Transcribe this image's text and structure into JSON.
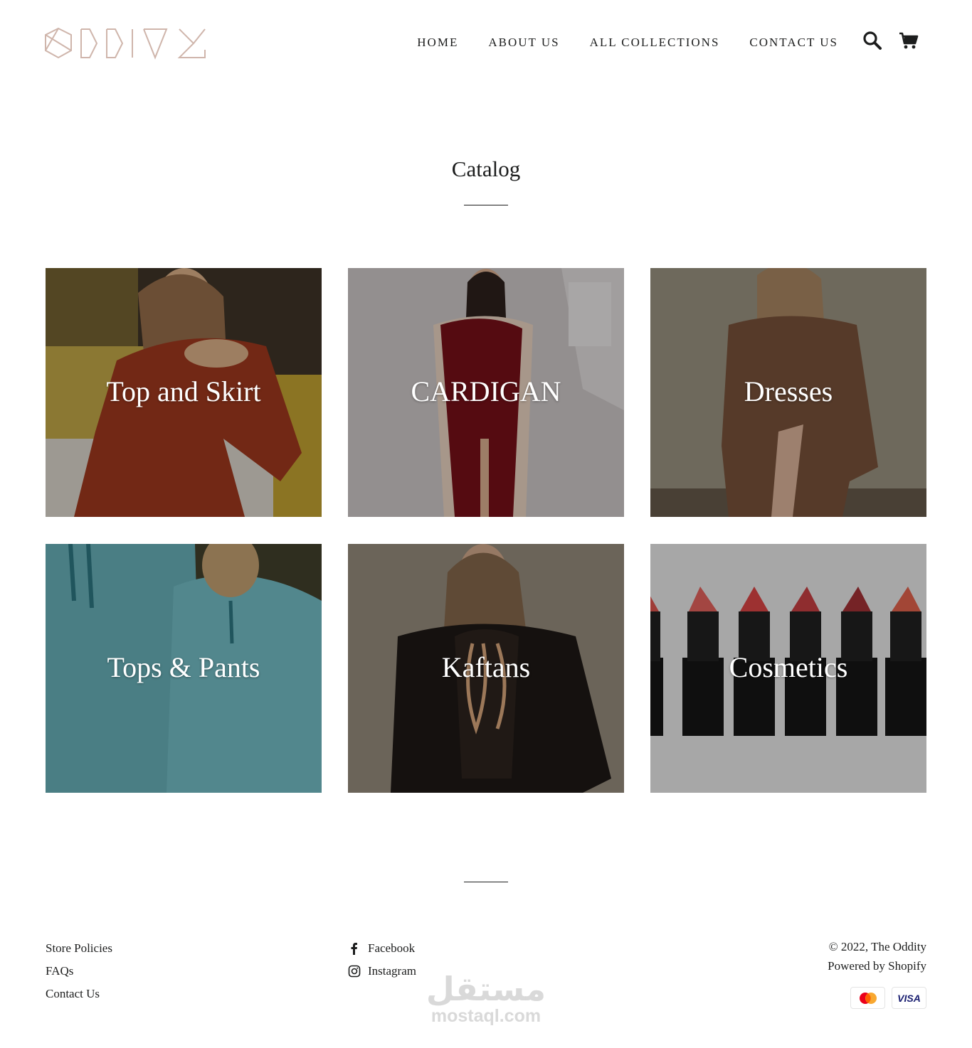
{
  "brand": {
    "logo_text": "ODDITY",
    "logo_color": "#cfb5ab"
  },
  "nav": {
    "items": [
      {
        "label": "HOME"
      },
      {
        "label": "ABOUT US"
      },
      {
        "label": "ALL COLLECTIONS"
      },
      {
        "label": "CONTACT US"
      }
    ],
    "icons": [
      "search-icon",
      "cart-icon"
    ]
  },
  "page": {
    "title": "Catalog"
  },
  "collections": [
    {
      "label": "Top and Skirt",
      "image": "woman in rust off-shoulder top and skirt seated"
    },
    {
      "label": "CARDIGAN",
      "image": "woman in burgundy velvet long cardigan"
    },
    {
      "label": "Dresses",
      "image": "woman in brown satin wrap dress"
    },
    {
      "label": "Tops & Pants",
      "image": "couple in light blue hoodies"
    },
    {
      "label": "Kaftans",
      "image": "woman in black embroidered kaftan"
    },
    {
      "label": "Cosmetics",
      "image": "row of red lipsticks"
    }
  ],
  "footer": {
    "links": [
      {
        "label": "Store Policies"
      },
      {
        "label": "FAQs"
      },
      {
        "label": "Contact Us"
      }
    ],
    "social": [
      {
        "label": "Facebook",
        "icon": "facebook-icon"
      },
      {
        "label": "Instagram",
        "icon": "instagram-icon"
      }
    ],
    "copyright": "© 2022, The Oddity",
    "powered_by": "Powered by Shopify",
    "payments": [
      "mastercard-icon",
      "visa-icon"
    ],
    "visa_label": "VISA"
  },
  "watermark": {
    "arabic": "مستقل",
    "latin": "mostaql.com"
  }
}
